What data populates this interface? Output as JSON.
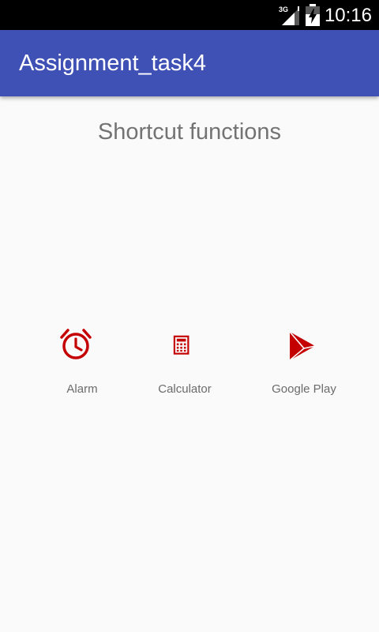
{
  "status_bar": {
    "network_label": "3G",
    "time": "10:16"
  },
  "app_bar": {
    "title": "Assignment_task4"
  },
  "main": {
    "heading": "Shortcut functions",
    "shortcuts": [
      {
        "label": "Alarm",
        "icon": "alarm-clock-icon"
      },
      {
        "label": "Calculator",
        "icon": "calculator-icon"
      },
      {
        "label": "Google Play",
        "icon": "google-play-icon"
      }
    ]
  },
  "colors": {
    "status_bar": "#000000",
    "app_bar": "#3f51b5",
    "background": "#fafafa",
    "icon_red": "#c40000",
    "heading_text": "#737373",
    "label_text": "#6b6b6b"
  }
}
